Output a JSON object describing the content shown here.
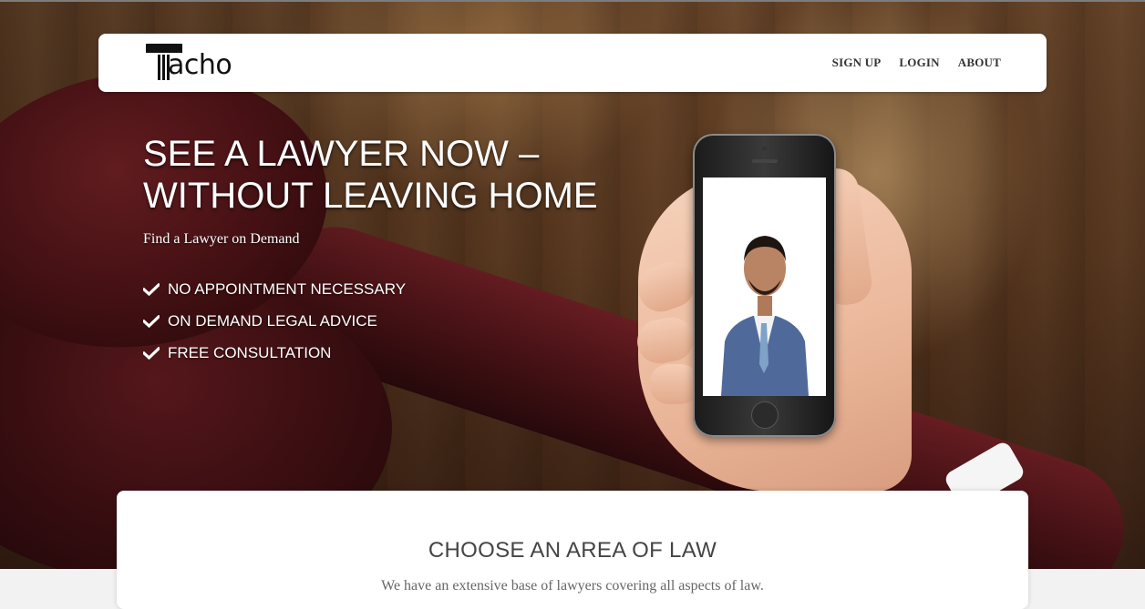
{
  "header": {
    "logo_text": "acho",
    "logo_letter": "T",
    "nav": [
      {
        "label": "SIGN UP"
      },
      {
        "label": "LOGIN"
      },
      {
        "label": "ABOUT"
      }
    ]
  },
  "hero": {
    "headline": "SEE A LAWYER NOW –\nWITHOUT LEAVING HOME",
    "subtitle": "Find a Lawyer on Demand",
    "features": [
      {
        "label": "NO APPOINTMENT NECESSARY",
        "icon": "check-icon"
      },
      {
        "label": "ON DEMAND LEGAL ADVICE",
        "icon": "check-icon"
      },
      {
        "label": "FREE CONSULTATION",
        "icon": "check-icon"
      }
    ]
  },
  "area_of_law": {
    "title": "CHOOSE AN AREA OF LAW",
    "description": "We have an extensive base of lawyers covering all aspects of law."
  },
  "colors": {
    "hero_text": "#ffffff",
    "nav_text": "#333333",
    "card_title": "#444444"
  }
}
